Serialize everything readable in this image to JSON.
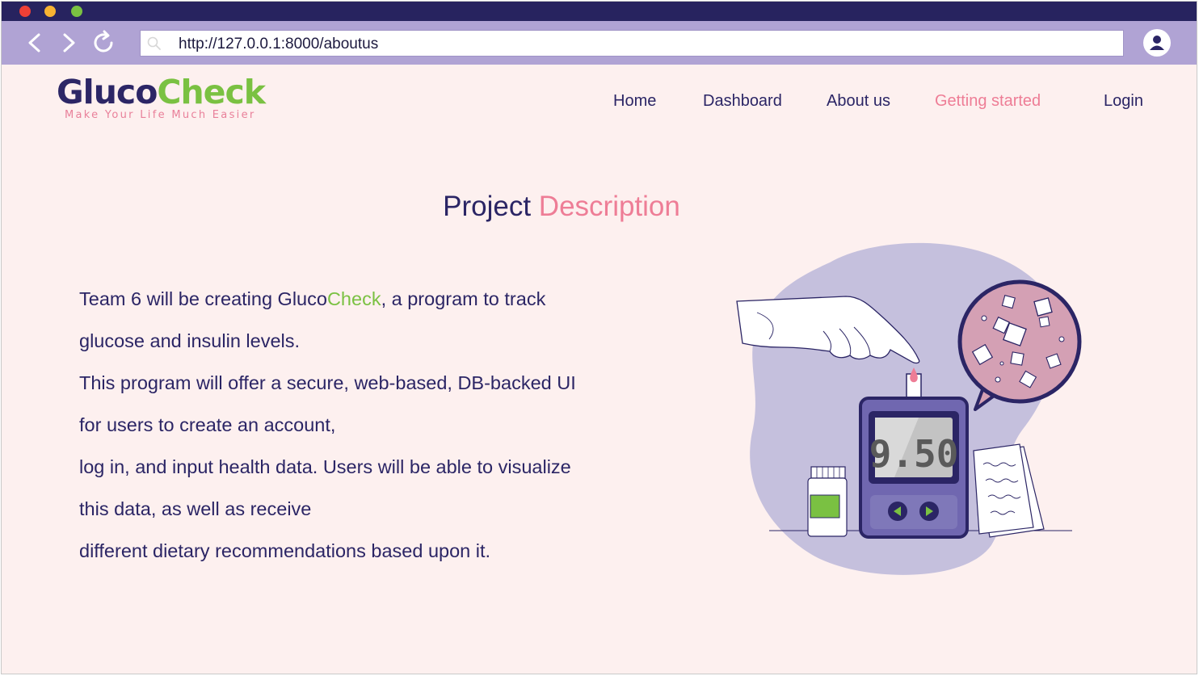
{
  "browser": {
    "url": "http://127.0.0.1:8000/aboutus",
    "icons": [
      "back-arrow-icon",
      "forward-arrow-icon",
      "reload-icon",
      "search-icon",
      "user-profile-icon"
    ]
  },
  "header": {
    "logo": {
      "part1": "Gluco",
      "part2": "Check",
      "tagline": "Make Your Life Much Easier"
    },
    "nav": {
      "home": "Home",
      "dashboard": "Dashboard",
      "about": "About us",
      "getting_started": "Getting started",
      "login": "Login"
    }
  },
  "main": {
    "title_part1": "Project",
    "title_part2": "Description",
    "description": {
      "line1_pre": "Team 6 will be creating Gluco",
      "line1_highlight": "Check",
      "line1_post": ", a program to track",
      "line2": "glucose and insulin levels.",
      "line3": "This program will offer a secure, web-based, DB-backed UI",
      "line4": "for users to create an account,",
      "line5": "log in, and input health data. Users will be able to visualize",
      "line6": "this data, as well as receive",
      "line7": "different dietary recommendations based upon it."
    },
    "illustration": {
      "meter_reading": "9.50"
    }
  },
  "colors": {
    "navy": "#2b2565",
    "pink": "#ee7d96",
    "green": "#7ac142",
    "lavender": "#b0a3d4",
    "background": "#fdf0ef",
    "titlebar": "#27235f"
  }
}
